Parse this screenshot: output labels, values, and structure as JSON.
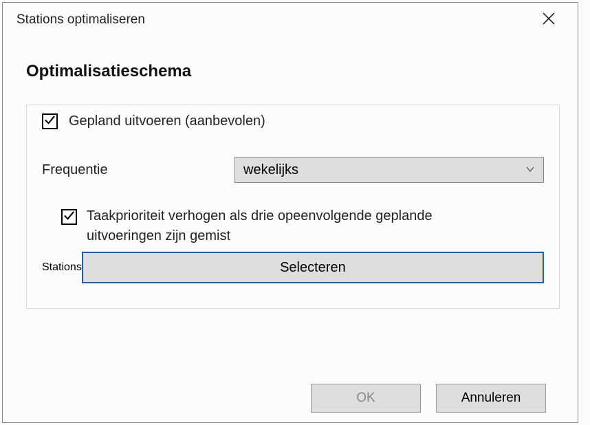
{
  "window": {
    "title": "Stations optimaliseren"
  },
  "heading": "Optimalisatieschema",
  "scheduled": {
    "label": "Gepland uitvoeren (aanbevolen)",
    "checked": true
  },
  "frequency": {
    "label": "Frequentie",
    "value": "wekelijks"
  },
  "priority": {
    "label": "Taakprioriteit verhogen als drie opeenvolgende geplande uitvoeringen zijn gemist",
    "checked": true
  },
  "stations": {
    "label": "Stations",
    "button": "Selecteren"
  },
  "buttons": {
    "ok": "OK",
    "cancel": "Annuleren"
  }
}
